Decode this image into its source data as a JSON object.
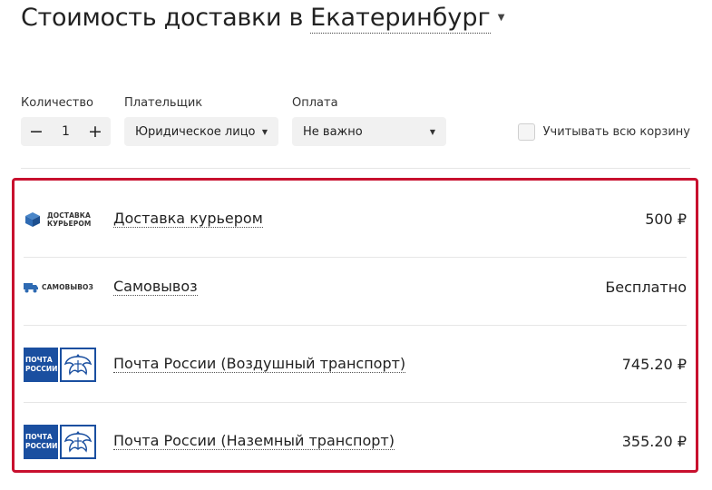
{
  "header": {
    "title": "Стоимость доставки в",
    "city": "Екатеринбург"
  },
  "filters": {
    "quantity_label": "Количество",
    "quantity_value": "1",
    "minus": "−",
    "plus": "+",
    "payer_label": "Плательщик",
    "payer_value": "Юридическое лицо",
    "payment_label": "Оплата",
    "payment_value": "Не важно",
    "cart_checkbox_label": "Учитывать всю корзину",
    "cart_checkbox_checked": false
  },
  "options": [
    {
      "logo_line1": "ДОСТАВКА",
      "logo_line2": "КУРЬЕРОМ",
      "name": "Доставка курьером",
      "price": "500 ₽",
      "icon": "box-icon"
    },
    {
      "logo_text": "САМОВЫВОЗ",
      "name": "Самовывоз",
      "price": "Бесплатно",
      "icon": "truck-icon"
    },
    {
      "logo_line1": "ПОЧТА",
      "logo_line2": "РОССИИ",
      "name": "Почта России (Воздушный транспорт)",
      "price": "745.20 ₽",
      "icon": "russian-post-eagle-icon"
    },
    {
      "logo_line1": "ПОЧТА",
      "logo_line2": "РОССИИ",
      "name": "Почта России (Наземный транспорт)",
      "price": "355.20 ₽",
      "icon": "russian-post-eagle-icon"
    }
  ],
  "colors": {
    "highlight_border": "#c8102e",
    "post_blue": "#1a4fa0",
    "courier_blue": "#2f6bb3"
  }
}
